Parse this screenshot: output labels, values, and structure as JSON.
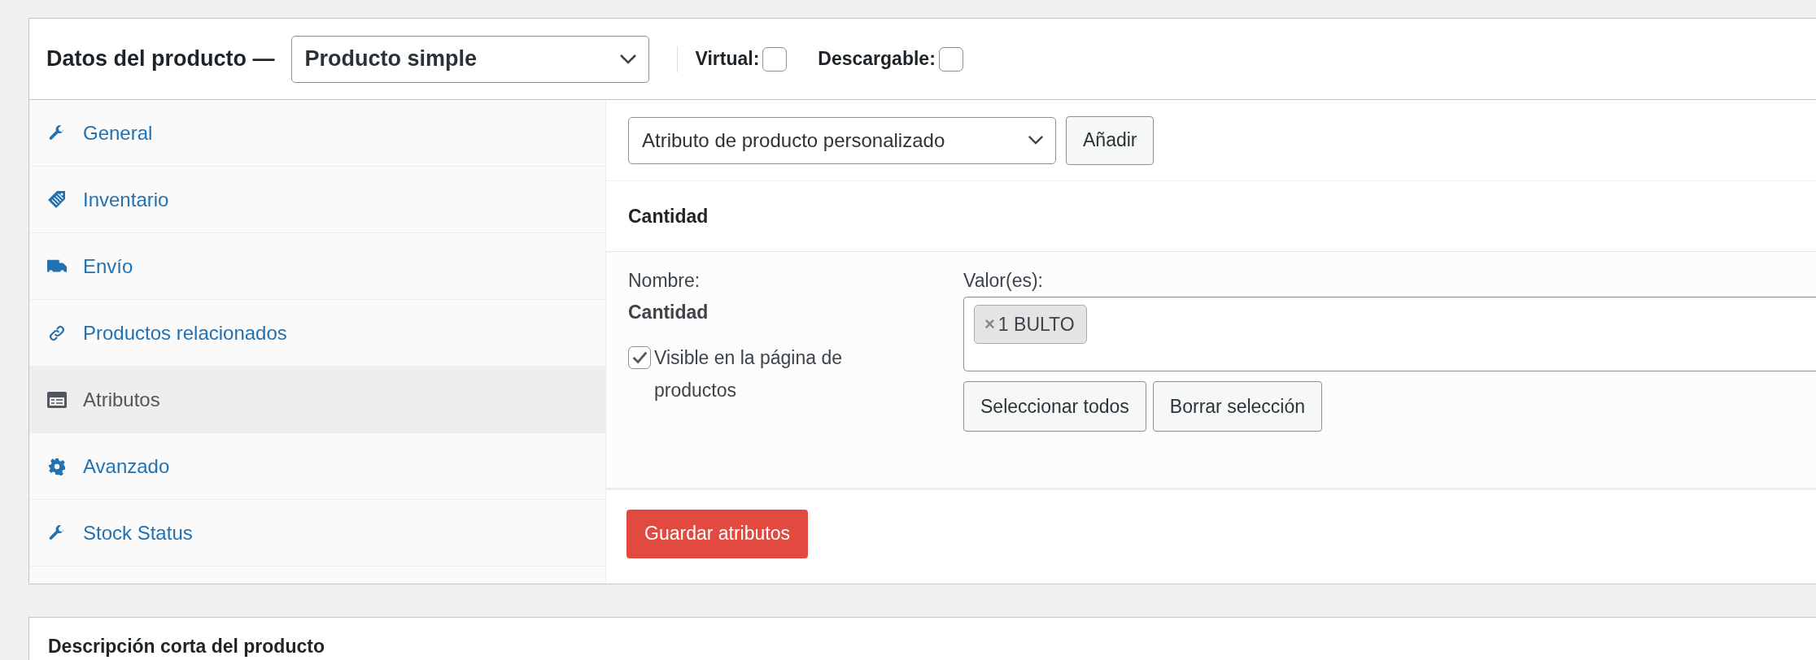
{
  "product_data": {
    "title": "Datos del producto —",
    "product_type": "Producto simple",
    "options": [
      {
        "label": "Virtual:",
        "checked": false
      },
      {
        "label": "Descargable:",
        "checked": false
      }
    ]
  },
  "tabs": [
    {
      "label": "General",
      "kind": "wrench",
      "selected": false
    },
    {
      "label": "Inventario",
      "kind": "tag",
      "selected": false
    },
    {
      "label": "Envío",
      "kind": "truck",
      "selected": false
    },
    {
      "label": "Productos relacionados",
      "kind": "link",
      "selected": false
    },
    {
      "label": "Atributos",
      "kind": "list",
      "selected": true
    },
    {
      "label": "Avanzado",
      "kind": "gear",
      "selected": false
    },
    {
      "label": "Stock Status",
      "kind": "wrench",
      "selected": false
    }
  ],
  "attributes": {
    "attribute_select": "Atributo de producto personalizado",
    "add_button": "Añadir",
    "attribute": {
      "title": "Cantidad",
      "name_label": "Nombre:",
      "name": "Cantidad",
      "visible": {
        "label": "Visible en la página de productos",
        "checked": true
      },
      "values_label": "Valor(es):",
      "values": [
        {
          "remove": "×",
          "label": "1 BULTO"
        }
      ],
      "select_all": "Seleccionar todos",
      "clear": "Borrar selección"
    },
    "save_button": "Guardar atributos"
  },
  "short_description": {
    "title": "Descripción corta del producto"
  }
}
